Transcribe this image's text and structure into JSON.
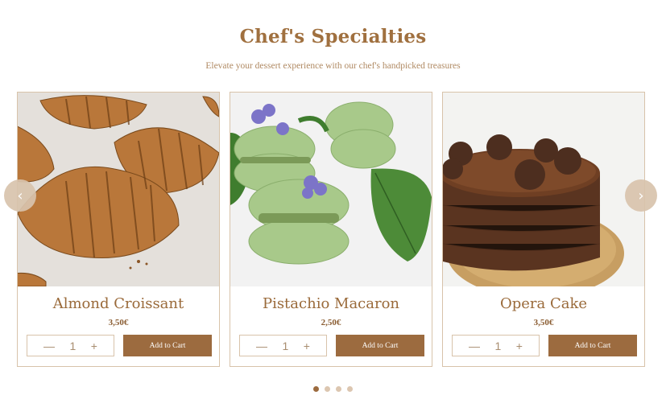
{
  "section": {
    "title": "Chef's Specialties",
    "subtitle": "Elevate your dessert experience with our chef's handpicked treasures"
  },
  "products": [
    {
      "name": "Almond Croissant",
      "price": "3,50€",
      "quantity": "1",
      "add_label": "Add to Cart",
      "image": "croissants-photo"
    },
    {
      "name": "Pistachio Macaron",
      "price": "2,50€",
      "quantity": "1",
      "add_label": "Add to Cart",
      "image": "macarons-photo"
    },
    {
      "name": "Opera Cake",
      "price": "3,50€",
      "quantity": "1",
      "add_label": "Add to Cart",
      "image": "chocolate-cake-photo"
    }
  ],
  "stepper": {
    "minus": "—",
    "plus": "+"
  },
  "carousel": {
    "prev_icon": "chevron-left-icon",
    "next_icon": "chevron-right-icon",
    "prev_glyph": "‹",
    "next_glyph": "›",
    "pages": 4,
    "active_page": 1
  },
  "colors": {
    "accent": "#9c6b3f",
    "title": "#a0703f",
    "border": "#d8c3aa",
    "arrow_bg": "#d9c4ad"
  }
}
